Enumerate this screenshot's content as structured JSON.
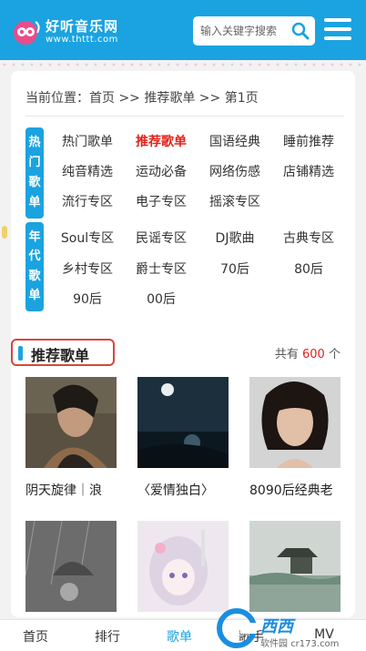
{
  "header": {
    "logo_text": "好听音乐网",
    "logo_url": "www.thttt.com",
    "search_placeholder": "输入关键字搜索"
  },
  "breadcrumb": "当前位置：首页 >> 推荐歌单 >> 第1页",
  "categories": {
    "hot_label": [
      "热",
      "门",
      "歌",
      "单"
    ],
    "era_label": [
      "年",
      "代",
      "歌",
      "单"
    ],
    "hot_tags": [
      "热门歌单",
      "推荐歌单",
      "国语经典",
      "睡前推荐",
      "纯音精选",
      "运动必备",
      "网络伤感",
      "店铺精选",
      "流行专区",
      "电子专区",
      "摇滚专区"
    ],
    "era_tags": [
      "Soul专区",
      "民谣专区",
      "DJ歌曲",
      "古典专区",
      "乡村专区",
      "爵士专区",
      "70后",
      "80后",
      "90后",
      "00后"
    ],
    "active_tag": "推荐歌单"
  },
  "section": {
    "title": "推荐歌单",
    "count_prefix": "共有",
    "count": "600",
    "count_suffix": "个"
  },
  "playlists": [
    {
      "title": "阴天旋律｜浪"
    },
    {
      "title": "〈爱情独白〉"
    },
    {
      "title": "8090后经典老"
    },
    {
      "title": ""
    },
    {
      "title": ""
    },
    {
      "title": ""
    }
  ],
  "bottom_nav": [
    "首页",
    "排行",
    "歌单",
    "歌手",
    "MV"
  ],
  "watermark": {
    "text": "西西",
    "sub": "软件园",
    "url": "cr173.com"
  },
  "colors": {
    "brand": "#1aa3e0",
    "active": "#e2231a"
  }
}
